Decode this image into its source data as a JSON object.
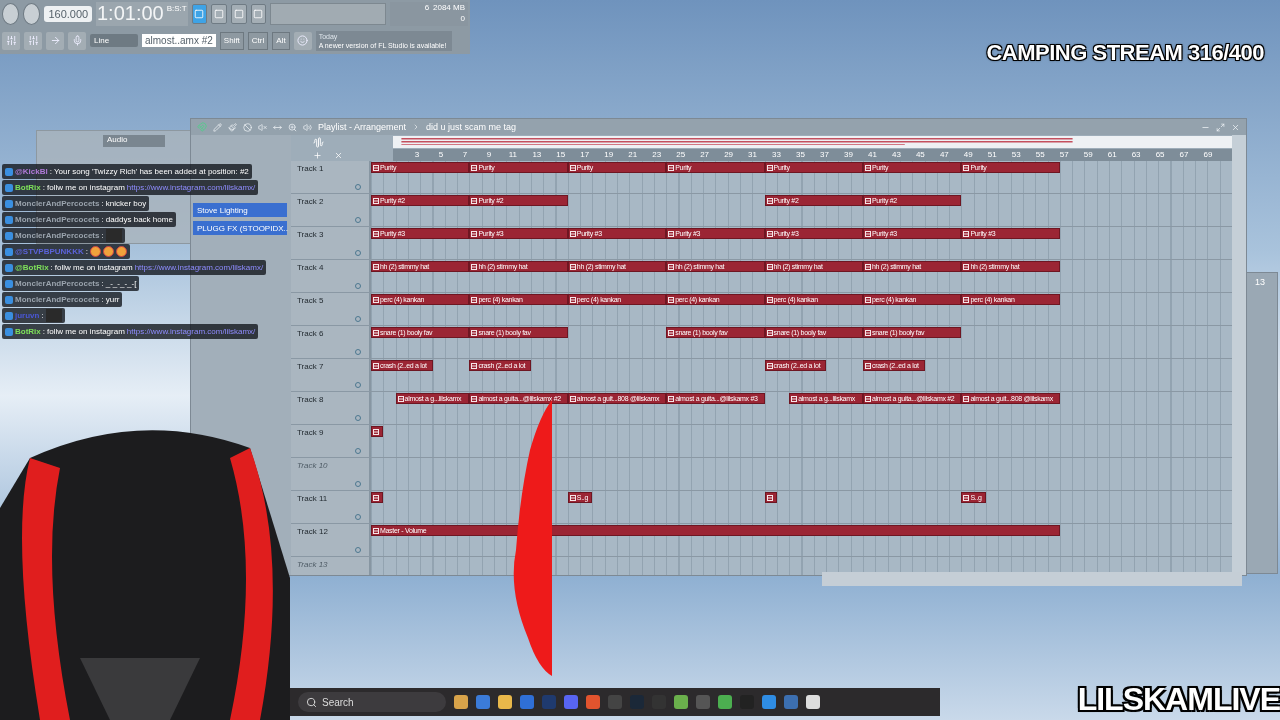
{
  "stream_title": "CAMPING STREAM 316/400",
  "channel_name": "LILSKAMLIVE",
  "toolbar": {
    "tempo": "160.000",
    "time": "1:01:00",
    "time_unit": "B:S:T",
    "cpu": "6",
    "memory": "2084 MB",
    "polyphony": "0",
    "snap": "Line",
    "pattern": "almost..amx #2",
    "keys": [
      "Shift",
      "Ctrl",
      "Alt"
    ],
    "hint_label": "Today",
    "hint": "A newer version of FL Studio is available!",
    "modes": [
      {
        "selected": true
      },
      {
        "selected": false
      },
      {
        "selected": false
      },
      {
        "selected": false
      }
    ]
  },
  "channel_rack": {
    "filter": "Audio"
  },
  "picker": {
    "items": [
      "Stove Lighting",
      "PLUGG FX (STOOPIDX.."
    ]
  },
  "chat": [
    {
      "kind": "text",
      "user": "@KickBl",
      "color": "#b07ad8",
      "sep": ":",
      "text": "Your song 'Twizzy Rich' has been added at position: #2"
    },
    {
      "kind": "link",
      "user": "BotRix",
      "color": "#7ee05a",
      "sep": ":",
      "text": "follw me on instagram",
      "link": "https://www.instagram.com/lilskamx/"
    },
    {
      "kind": "text",
      "user": "MonclerAndPercocets",
      "color": "#9aa3ad",
      "sep": ":",
      "text": "knicker boy"
    },
    {
      "kind": "text",
      "user": "MonclerAndPercocets",
      "color": "#9aa3ad",
      "sep": ":",
      "text": "daddys back home"
    },
    {
      "kind": "image",
      "user": "MonclerAndPercocets",
      "color": "#9aa3ad",
      "sep": ":"
    },
    {
      "kind": "emotes",
      "user": "@STVPBPUNKKK",
      "color": "#5b63d9",
      "sep": ":"
    },
    {
      "kind": "link",
      "user": "@BotRix",
      "color": "#7ee05a",
      "sep": ":",
      "text": "follw me on instagram",
      "link": "https://www.instagram.com/lilskamx/"
    },
    {
      "kind": "text",
      "user": "MonclerAndPercocets",
      "color": "#9aa3ad",
      "sep": ":",
      "text": "_-_-_-_-["
    },
    {
      "kind": "text",
      "user": "MonclerAndPercocets",
      "color": "#9aa3ad",
      "sep": ":",
      "text": "yurr"
    },
    {
      "kind": "image",
      "user": "juruvn",
      "color": "#4a57d6",
      "sep": ":"
    },
    {
      "kind": "link",
      "user": "BotRix",
      "color": "#7ee05a",
      "sep": ":",
      "text": "follw me on instagram",
      "link": "https://www.instagram.com/lilskamx/"
    }
  ],
  "playlist": {
    "title": "Playlist - Arrangement",
    "arrangement": "did u just scam me tag",
    "ruler": [
      "3",
      "5",
      "7",
      "9",
      "11",
      "13",
      "15",
      "17",
      "19",
      "21",
      "23",
      "25",
      "27",
      "29",
      "31",
      "33",
      "35",
      "37",
      "39",
      "41",
      "43",
      "45",
      "47",
      "49",
      "51",
      "53",
      "55",
      "57",
      "59",
      "61",
      "63",
      "65",
      "67",
      "69"
    ],
    "tracks": [
      {
        "name": "Track 1",
        "dimmed": false,
        "clips": [
          {
            "label": "Purity"
          },
          {
            "label": "Purity"
          },
          {
            "label": "Purity"
          },
          {
            "label": "Purity"
          },
          {
            "label": "Purity"
          },
          {
            "label": "Purity"
          },
          {
            "label": "Purity"
          }
        ]
      },
      {
        "name": "Track 2",
        "dimmed": false,
        "clips": [
          {
            "label": "Purity #2"
          },
          {
            "label": "Purity #2"
          },
          {
            "label": "Purity #2"
          },
          {
            "label": "Purity #2"
          }
        ]
      },
      {
        "name": "Track 3",
        "dimmed": false,
        "clips": [
          {
            "label": "Purity #3"
          },
          {
            "label": "Purity #3"
          },
          {
            "label": "Purity #3"
          },
          {
            "label": "Purity #3"
          },
          {
            "label": "Purity #3"
          },
          {
            "label": "Purity #3"
          },
          {
            "label": "Purity #3"
          }
        ]
      },
      {
        "name": "Track 4",
        "dimmed": false,
        "clips": [
          {
            "label": "hh (2) stimmy hat"
          },
          {
            "label": "hh (2) stimmy hat"
          },
          {
            "label": "hh (2) stimmy hat"
          },
          {
            "label": "hh (2) stimmy hat"
          },
          {
            "label": "hh (2) stimmy hat"
          },
          {
            "label": "hh (2) stimmy hat"
          },
          {
            "label": "hh (2) stimmy hat"
          }
        ]
      },
      {
        "name": "Track 5",
        "dimmed": false,
        "clips": [
          {
            "label": "perc (4) kankan"
          },
          {
            "label": "perc (4) kankan"
          },
          {
            "label": "perc (4) kankan"
          },
          {
            "label": "perc (4) kankan"
          },
          {
            "label": "perc (4) kankan"
          },
          {
            "label": "perc (4) kankan"
          },
          {
            "label": "perc (4) kankan"
          }
        ]
      },
      {
        "name": "Track 6",
        "dimmed": false,
        "clips": [
          {
            "label": "snare (1) booly fav"
          },
          {
            "label": "snare (1) booly fav"
          },
          {
            "label": "snare (1) booly fav"
          },
          {
            "label": "snare (1) booly fav"
          },
          {
            "label": "snare (1) booly fav"
          }
        ]
      },
      {
        "name": "Track 7",
        "dimmed": false,
        "clips": [
          {
            "label": "crash (2..ed a lot"
          },
          {
            "label": "crash (2..ed a lot"
          },
          {
            "label": "crash (2..ed a lot"
          },
          {
            "label": "crash (2..ed a lot"
          }
        ]
      },
      {
        "name": "Track 8",
        "dimmed": false,
        "clips": [
          {
            "label": "almost a g...lilskamx"
          },
          {
            "label": "almost a guita...@lilskamx #2"
          },
          {
            "label": "almost a guit...808 @lilskamx"
          },
          {
            "label": "almost a guita...@lilskamx #3"
          },
          {
            "label": "almost a g...lilskamx"
          },
          {
            "label": "almost a guita...@lilskamx #2"
          },
          {
            "label": "almost a guit...808 @lilskamx"
          }
        ]
      },
      {
        "name": "Track 9",
        "dimmed": false,
        "clips": [
          {
            "kind": "marker"
          }
        ]
      },
      {
        "name": "Track 10",
        "dimmed": true
      },
      {
        "name": "Track 11",
        "dimmed": false,
        "clips": [
          {
            "kind": "marker"
          },
          {
            "label": "S..g"
          },
          {
            "kind": "marker"
          },
          {
            "label": "S..g"
          }
        ]
      },
      {
        "name": "Track 12",
        "dimmed": false,
        "clips": [
          {
            "label": "Master - Volume"
          }
        ]
      },
      {
        "name": "Track 13",
        "dimmed": true
      }
    ]
  },
  "mixer": {
    "insert": "13"
  },
  "taskbar": {
    "search": "Search"
  }
}
